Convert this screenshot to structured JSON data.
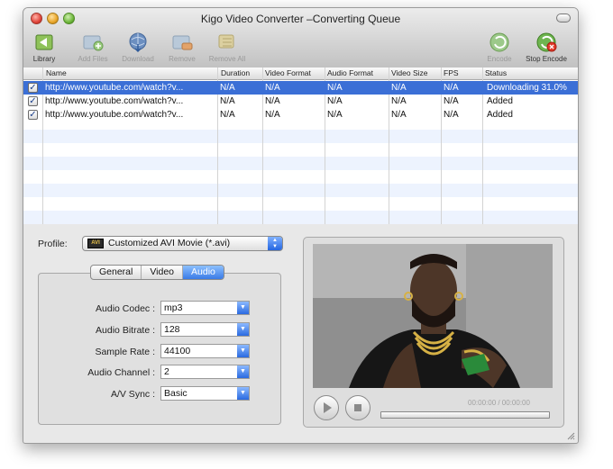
{
  "window": {
    "title": "Kigo Video Converter –Converting Queue"
  },
  "toolbar": {
    "library": "Library",
    "add_files": "Add Files",
    "download": "Download",
    "remove": "Remove",
    "remove_all": "Remove All",
    "encode": "Encode",
    "stop_encode": "Stop Encode"
  },
  "table": {
    "columns": [
      "Name",
      "Duration",
      "Video Format",
      "Audio Format",
      "Video Size",
      "FPS",
      "Status"
    ],
    "rows": [
      {
        "name": "http://www.youtube.com/watch?v...",
        "duration": "N/A",
        "video_format": "N/A",
        "audio_format": "N/A",
        "video_size": "N/A",
        "fps": "N/A",
        "status": "Downloading 31.0%",
        "checked": "✓"
      },
      {
        "name": "http://www.youtube.com/watch?v...",
        "duration": "N/A",
        "video_format": "N/A",
        "audio_format": "N/A",
        "video_size": "N/A",
        "fps": "N/A",
        "status": "Added",
        "checked": "✓"
      },
      {
        "name": "http://www.youtube.com/watch?v...",
        "duration": "N/A",
        "video_format": "N/A",
        "audio_format": "N/A",
        "video_size": "N/A",
        "fps": "N/A",
        "status": "Added",
        "checked": "✓"
      }
    ]
  },
  "profile": {
    "label": "Profile:",
    "value": "Customized AVI Movie (*.avi)",
    "badge": "AVI"
  },
  "tabs": [
    "General",
    "Video",
    "Audio"
  ],
  "audio_settings": {
    "codec_label": "Audio Codec :",
    "codec_value": "mp3",
    "bitrate_label": "Audio Bitrate :",
    "bitrate_value": "128",
    "sample_rate_label": "Sample Rate :",
    "sample_rate_value": "44100",
    "channel_label": "Audio Channel :",
    "channel_value": "2",
    "av_sync_label": "A/V Sync :",
    "av_sync_value": "Basic"
  },
  "player": {
    "timecode": "00:00:00 / 00:00:00",
    "progress": 0
  },
  "colors": {
    "selection": "#3b6fd6",
    "stripe": "#edf3fe",
    "accent": "#2a6ae0"
  }
}
